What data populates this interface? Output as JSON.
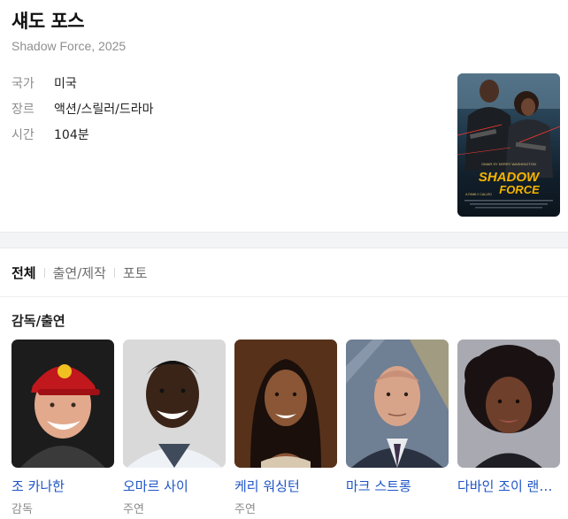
{
  "movie": {
    "title": "섀도 포스",
    "subtitle": "Shadow Force, 2025",
    "info": [
      {
        "label": "국가",
        "value": "미국"
      },
      {
        "label": "장르",
        "value": "액션/스릴러/드라마"
      },
      {
        "label": "시간",
        "value": "104분"
      }
    ],
    "poster": {
      "headline": "SHADOW",
      "headline2": "FORCE",
      "tagline": "A FAMILY CALLED",
      "top_names": "OMAR SY    KERRY WASHINGTON"
    }
  },
  "tabs": [
    {
      "label": "전체",
      "active": true
    },
    {
      "label": "출연/제작",
      "active": false
    },
    {
      "label": "포토",
      "active": false
    }
  ],
  "cast_section": {
    "title": "감독/출연",
    "people": [
      {
        "name": "조 카나한",
        "role": "감독"
      },
      {
        "name": "오마르 사이",
        "role": "주연"
      },
      {
        "name": "케리 워싱턴",
        "role": "주연"
      },
      {
        "name": "마크 스트롱",
        "role": ""
      },
      {
        "name": "다바인 조이 랜돌프",
        "role": ""
      }
    ]
  },
  "colors": {
    "link": "#1f55c6",
    "muted": "#8b8b8b",
    "band": "#f3f4f6"
  }
}
